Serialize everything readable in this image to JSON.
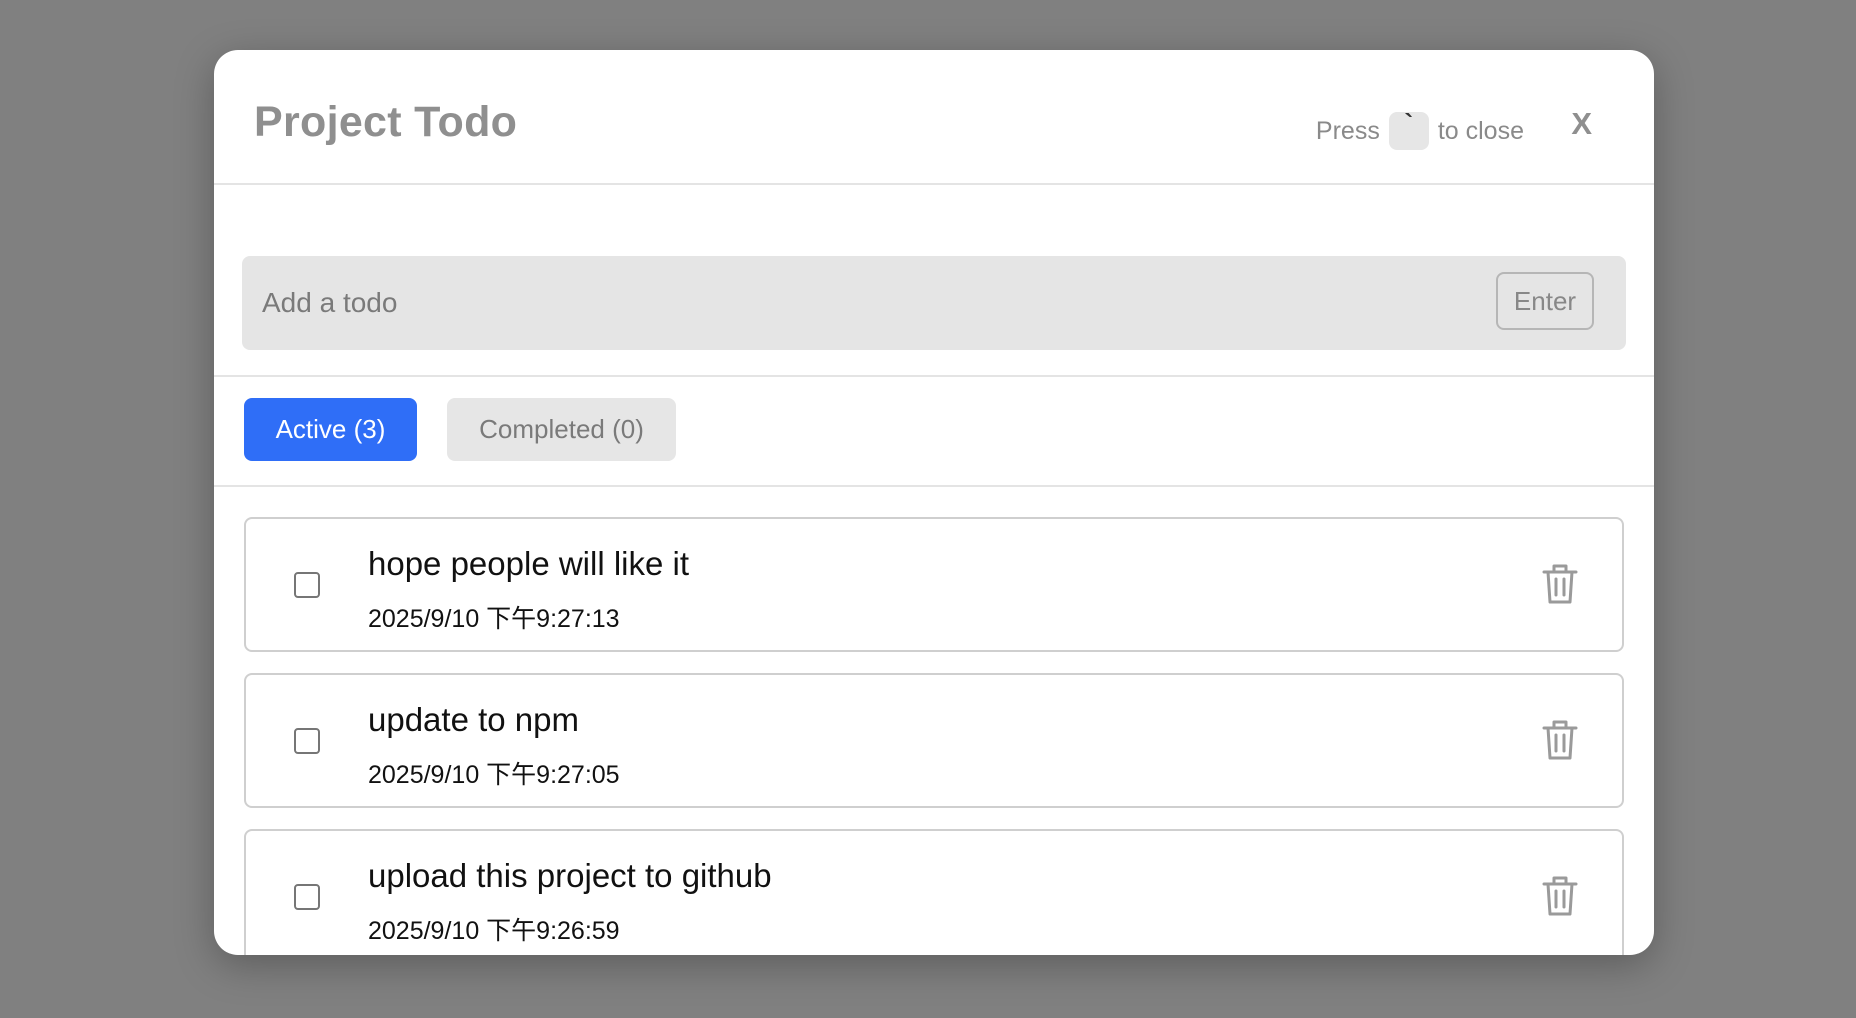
{
  "header": {
    "title": "Project Todo",
    "close_hint_prefix": "Press",
    "close_hint_key": "`",
    "close_hint_suffix": "to close",
    "close_label": "X"
  },
  "input": {
    "placeholder": "Add a todo",
    "value": "",
    "enter_label": "Enter"
  },
  "tabs": [
    {
      "label": "Active (3)",
      "active": true
    },
    {
      "label": "Completed (0)",
      "active": false
    }
  ],
  "todos": [
    {
      "text": "hope people will like it",
      "date": "2025/9/10 下午9:27:13",
      "checked": false
    },
    {
      "text": "update to npm",
      "date": "2025/9/10 下午9:27:05",
      "checked": false
    },
    {
      "text": "upload this project to github",
      "date": "2025/9/10 下午9:26:59",
      "checked": false
    }
  ],
  "colors": {
    "accent": "#2f6ef7",
    "backdrop": "#808080",
    "muted_text": "#8f8f8f"
  },
  "icons": {
    "delete": "trash-icon",
    "close": "close-icon"
  }
}
